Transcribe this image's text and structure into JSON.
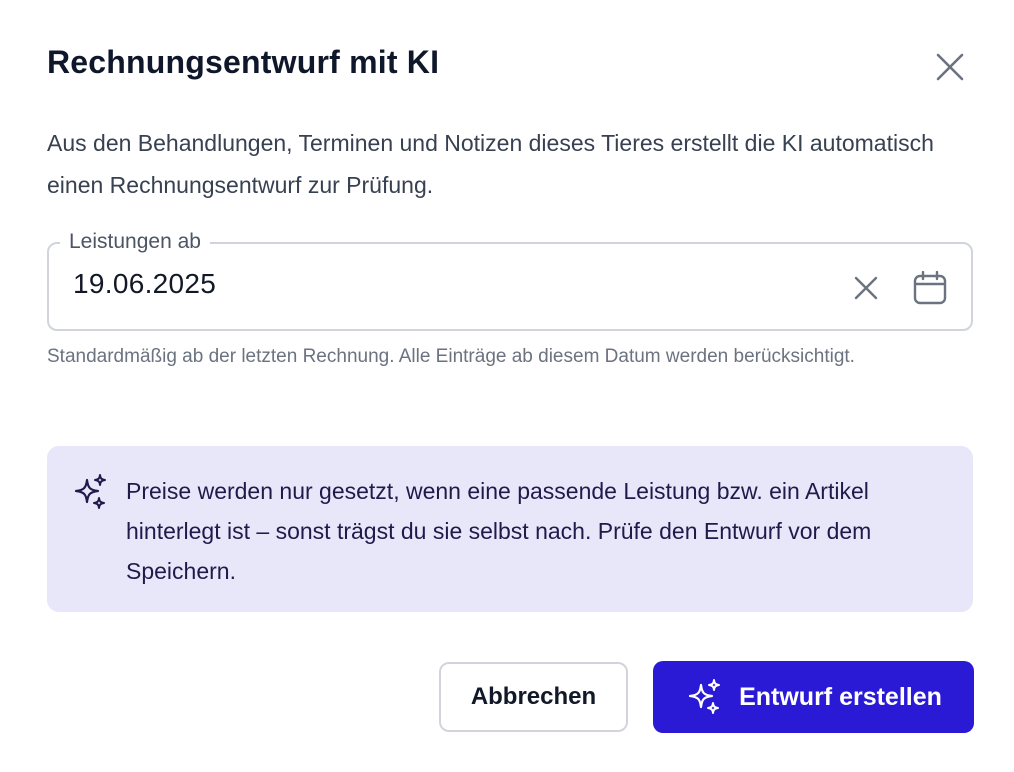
{
  "dialog": {
    "title": "Rechnungsentwurf mit KI",
    "close_icon": "close-icon",
    "description": "Aus den Behandlungen, Terminen und Notizen dieses Tieres erstellt die KI automatisch einen Rechnungsentwurf zur Prüfung."
  },
  "date_field": {
    "label": "Leistungen ab",
    "value": "19.06.2025",
    "clear_icon": "clear-icon",
    "calendar_icon": "calendar-icon",
    "helper": "Standardmäßig ab der letzten Rechnung. Alle Einträge ab diesem Datum werden berücksichtigt."
  },
  "info_box": {
    "icon": "sparkles-icon",
    "text": "Preise werden nur gesetzt, wenn eine passende Leistung bzw. ein Artikel hinterlegt ist – sonst trägst du sie selbst nach. Prüfe den Entwurf vor dem Speichern."
  },
  "actions": {
    "cancel_label": "Abbrechen",
    "submit_label": "Entwurf erstellen",
    "submit_icon": "sparkles-icon"
  },
  "colors": {
    "primary": "#2a1ad6",
    "info_background": "#e8e7fa",
    "info_text": "#1e1b4b",
    "border": "#d1d5db"
  }
}
